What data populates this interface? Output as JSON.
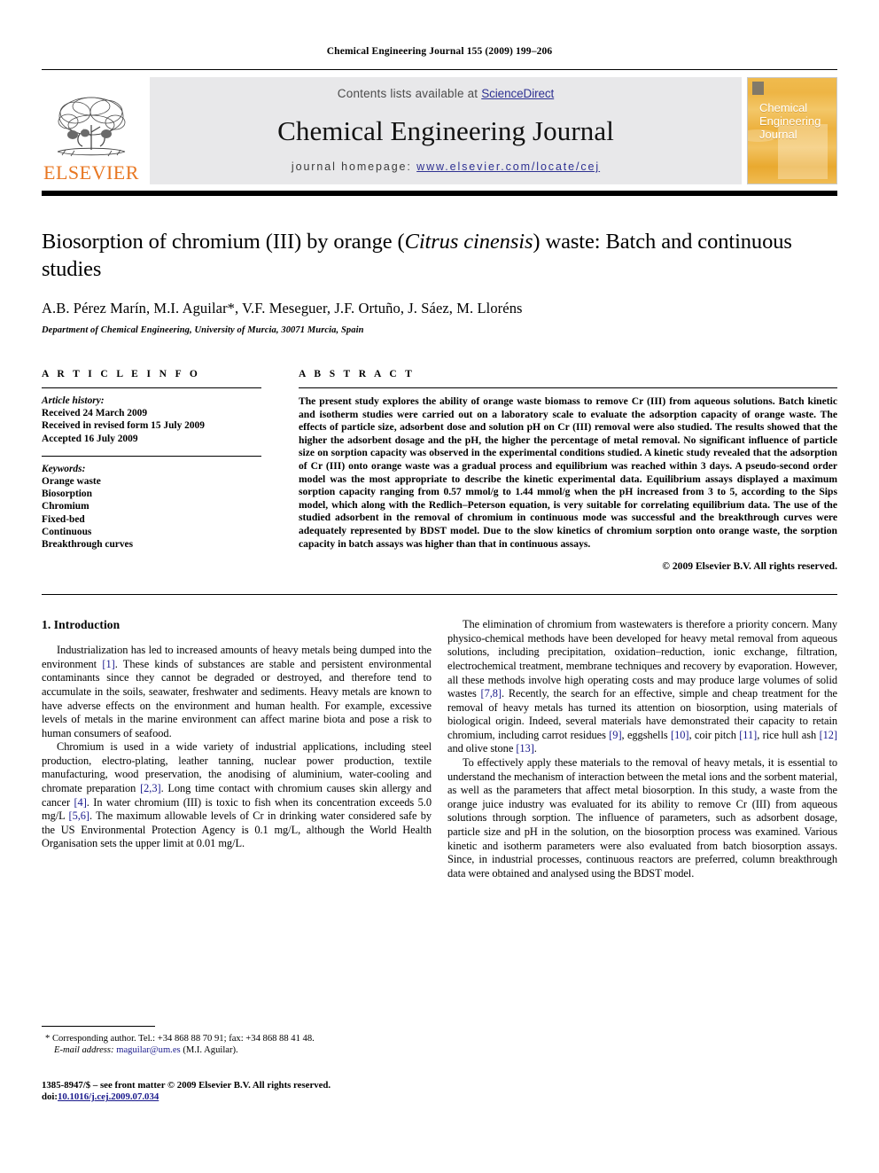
{
  "running_head": "Chemical Engineering Journal 155 (2009) 199–206",
  "masthead": {
    "contents_prefix": "Contents lists available at ",
    "sciencedirect": "ScienceDirect",
    "journal_title": "Chemical Engineering Journal",
    "homepage_prefix": "journal homepage: ",
    "homepage_url": "www.elsevier.com/locate/cej",
    "publisher": "ELSEVIER",
    "cover_text": "Chemical\nEngineering\nJournal",
    "accent_orange": "#E87722",
    "link_blue": "#2e3192",
    "banner_bg": "#e8e8ea"
  },
  "article": {
    "title_part1": "Biosorption of chromium (III) by orange (",
    "title_species": "Citrus cinensis",
    "title_part2": ") waste: Batch and continuous studies",
    "authors": "A.B. Pérez Marín, M.I. Aguilar*, V.F. Meseguer, J.F. Ortuño, J. Sáez, M. Lloréns",
    "affiliation": "Department of Chemical Engineering, University of Murcia, 30071 Murcia, Spain"
  },
  "article_info": {
    "heading": "A R T I C L E   I N F O",
    "history_label": "Article history:",
    "history": [
      "Received 24 March 2009",
      "Received in revised form 15 July 2009",
      "Accepted 16 July 2009"
    ],
    "keywords_label": "Keywords:",
    "keywords": [
      "Orange waste",
      "Biosorption",
      "Chromium",
      "Fixed-bed",
      "Continuous",
      "Breakthrough curves"
    ]
  },
  "abstract": {
    "heading": "A B S T R A C T",
    "text": "The present study explores the ability of orange waste biomass to remove Cr (III) from aqueous solutions. Batch kinetic and isotherm studies were carried out on a laboratory scale to evaluate the adsorption capacity of orange waste. The effects of particle size, adsorbent dose and solution pH on Cr (III) removal were also studied. The results showed that the higher the adsorbent dosage and the pH, the higher the percentage of metal removal. No significant influence of particle size on sorption capacity was observed in the experimental conditions studied. A kinetic study revealed that the adsorption of Cr (III) onto orange waste was a gradual process and equilibrium was reached within 3 days. A pseudo-second order model was the most appropriate to describe the kinetic experimental data. Equilibrium assays displayed a maximum sorption capacity ranging from 0.57 mmol/g to 1.44 mmol/g when the pH increased from 3 to 5, according to the Sips model, which along with the Redlich–Peterson equation, is very suitable for correlating equilibrium data. The use of the studied adsorbent in the removal of chromium in continuous mode was successful and the breakthrough curves were adequately represented by BDST model. Due to the slow kinetics of chromium sorption onto orange waste, the sorption capacity in batch assays was higher than that in continuous assays.",
    "copyright": "© 2009 Elsevier B.V. All rights reserved."
  },
  "introduction": {
    "heading": "1. Introduction",
    "left_paragraphs": [
      "Industrialization has led to increased amounts of heavy metals being dumped into the environment [1]. These kinds of substances are stable and persistent environmental contaminants since they cannot be degraded or destroyed, and therefore tend to accumulate in the soils, seawater, freshwater and sediments. Heavy metals are known to have adverse effects on the environment and human health. For example, excessive levels of metals in the marine environment can affect marine biota and pose a risk to human consumers of seafood.",
      "Chromium is used in a wide variety of industrial applications, including steel production, electro-plating, leather tanning, nuclear power production, textile manufacturing, wood preservation, the anodising of aluminium, water-cooling and chromate preparation [2,3]. Long time contact with chromium causes skin allergy and cancer [4]. In water chromium (III) is toxic to fish when its concentration exceeds 5.0 mg/L [5,6]. The maximum allowable levels of Cr in drinking water considered safe by the US Environmental Protection Agency is 0.1 mg/L, although the World Health Organisation sets the upper limit at 0.01 mg/L."
    ],
    "right_paragraphs": [
      "The elimination of chromium from wastewaters is therefore a priority concern. Many physico-chemical methods have been developed for heavy metal removal from aqueous solutions, including precipitation, oxidation–reduction, ionic exchange, filtration, electrochemical treatment, membrane techniques and recovery by evaporation. However, all these methods involve high operating costs and may produce large volumes of solid wastes [7,8]. Recently, the search for an effective, simple and cheap treatment for the removal of heavy metals has turned its attention on biosorption, using materials of biological origin. Indeed, several materials have demonstrated their capacity to retain chromium, including carrot residues [9], eggshells [10], coir pitch [11], rice hull ash [12] and olive stone [13].",
      "To effectively apply these materials to the removal of heavy metals, it is essential to understand the mechanism of interaction between the metal ions and the sorbent material, as well as the parameters that affect metal biosorption. In this study, a waste from the orange juice industry was evaluated for its ability to remove Cr (III) from aqueous solutions through sorption. The influence of parameters, such as adsorbent dosage, particle size and pH in the solution, on the biosorption process was examined. Various kinetic and isotherm parameters were also evaluated from batch biosorption assays. Since, in industrial processes, continuous reactors are preferred, column breakthrough data were obtained and analysed using the BDST model."
    ]
  },
  "footnotes": {
    "corresponding": "* Corresponding author. Tel.: +34 868 88 70 91; fax: +34 868 88 41 48.",
    "email_label": "E-mail address:",
    "email": "maguilar@um.es",
    "email_owner": "(M.I. Aguilar).",
    "issn_line": "1385-8947/$ – see front matter © 2009 Elsevier B.V. All rights reserved.",
    "doi_label": "doi:",
    "doi": "10.1016/j.cej.2009.07.034"
  }
}
